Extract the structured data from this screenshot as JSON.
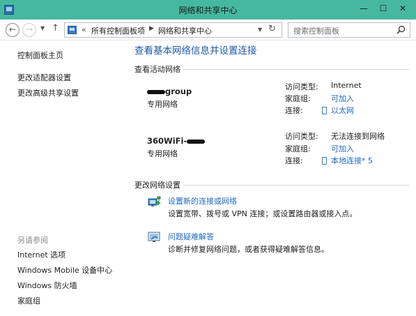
{
  "window": {
    "title": "网络和共享中心"
  },
  "address": {
    "crumb_sep0": "«",
    "crumb1": "所有控制面板项",
    "crumb_sep1": "▶",
    "crumb2": "网络和共享中心"
  },
  "search": {
    "placeholder": "搜索控制面板"
  },
  "sidebar": {
    "items": [
      {
        "label": "控制面板主页"
      },
      {
        "label": "更改适配器设置"
      },
      {
        "label": "更改高级共享设置"
      }
    ],
    "see_also_title": "另请参阅",
    "see_also": [
      {
        "label": "Internet 选项"
      },
      {
        "label": "Windows Mobile 设备中心"
      },
      {
        "label": "Windows 防火墙"
      },
      {
        "label": "家庭组"
      }
    ]
  },
  "main": {
    "title": "查看基本网络信息并设置连接",
    "active_networks_label": "查看活动网络",
    "networks": [
      {
        "name_suffix": "group",
        "type": "专用网络",
        "access_type_key": "访问类型:",
        "access_type_value": "Internet",
        "homegroup_key": "家庭组:",
        "homegroup_value": "可加入",
        "connection_key": "连接:",
        "connection_value": "以太网"
      },
      {
        "name_prefix": "360WiFi-",
        "type": "专用网络",
        "access_type_key": "访问类型:",
        "access_type_value": "无法连接到网络",
        "homegroup_key": "家庭组:",
        "homegroup_value": "可加入",
        "connection_key": "连接:",
        "connection_value": "本地连接* 5"
      }
    ],
    "change_settings_label": "更改网络设置",
    "tasks": [
      {
        "link": "设置新的连接或网络",
        "desc": "设置宽带、拨号或 VPN 连接；或设置路由器或接入点。"
      },
      {
        "link": "问题疑难解答",
        "desc": "诊断并修复网络问题，或者获得疑难解答信息。"
      }
    ]
  },
  "colors": {
    "titlebar": "#47b8a0",
    "link": "#1e6ac2",
    "heading": "#1e5aa8"
  }
}
